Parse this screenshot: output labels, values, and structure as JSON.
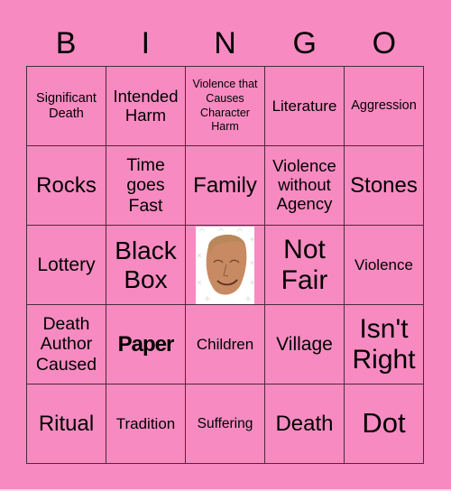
{
  "colors": {
    "background": "#F78BC1",
    "grid_line": "#4a2a3a",
    "text": "#000000"
  },
  "header": [
    "B",
    "I",
    "N",
    "G",
    "O"
  ],
  "cells": [
    {
      "text": "Significant Death",
      "lines": [
        "Significant",
        "Death"
      ]
    },
    {
      "text": "Intended Harm",
      "lines": [
        "Intended",
        "Harm"
      ]
    },
    {
      "text": "Violence that Causes Character Harm",
      "lines": [
        "Violence that",
        "Causes",
        "Character",
        "Harm"
      ]
    },
    {
      "text": "Literature",
      "lines": [
        "Literature"
      ]
    },
    {
      "text": "Aggression",
      "lines": [
        "Aggression"
      ]
    },
    {
      "text": "Rocks",
      "lines": [
        "Rocks"
      ]
    },
    {
      "text": "Time goes Fast",
      "lines": [
        "Time",
        "goes",
        "Fast"
      ]
    },
    {
      "text": "Family",
      "lines": [
        "Family"
      ]
    },
    {
      "text": "Violence without Agency",
      "lines": [
        "Violence",
        "without",
        "Agency"
      ]
    },
    {
      "text": "Stones",
      "lines": [
        "Stones"
      ]
    },
    {
      "text": "Lottery",
      "lines": [
        "Lottery"
      ]
    },
    {
      "text": "Black Box",
      "lines": [
        "Black",
        "Box"
      ]
    },
    {
      "text": "",
      "image": "face-photo-icon"
    },
    {
      "text": "Not Fair",
      "lines": [
        "Not",
        "Fair"
      ]
    },
    {
      "text": "Violence",
      "lines": [
        "Violence"
      ]
    },
    {
      "text": "Death Author Caused",
      "lines": [
        "Death",
        "Author",
        "Caused"
      ]
    },
    {
      "text": "Paper",
      "lines": [
        "Paper"
      ]
    },
    {
      "text": "Children",
      "lines": [
        "Children"
      ]
    },
    {
      "text": "Village",
      "lines": [
        "Village"
      ]
    },
    {
      "text": "Isn't Right",
      "lines": [
        "Isn't",
        "Right"
      ]
    },
    {
      "text": "Ritual",
      "lines": [
        "Ritual"
      ]
    },
    {
      "text": "Tradition",
      "lines": [
        "Tradition"
      ]
    },
    {
      "text": "Suffering",
      "lines": [
        "Suffering"
      ]
    },
    {
      "text": "Death",
      "lines": [
        "Death"
      ]
    },
    {
      "text": "Dot",
      "lines": [
        "Dot"
      ]
    }
  ]
}
